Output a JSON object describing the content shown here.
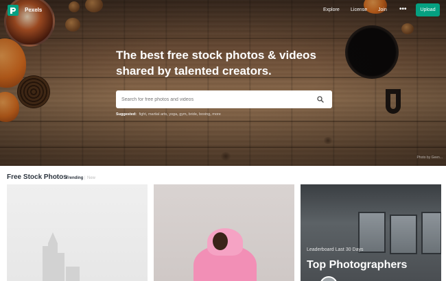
{
  "header": {
    "brand": "Pexels",
    "nav": [
      "Explore",
      "License",
      "Join"
    ],
    "more_label": "•••",
    "upload_label": "Upload"
  },
  "hero": {
    "headline": "The best free stock photos & videos shared by talented creators.",
    "search_placeholder": "Search for free photos and videos",
    "suggested_label": "Suggested:",
    "suggested_tags": [
      "fight",
      "martial arts",
      "yoga",
      "gym",
      "bride",
      "boxing",
      "more"
    ],
    "credit": "Photo by Geen..."
  },
  "section": {
    "title": "Free Stock Photos",
    "tabs": [
      "Trending",
      "New"
    ],
    "separator": "|",
    "active_tab": "Trending"
  },
  "leaderboard": {
    "kicker": "Leaderboard Last 30 Days",
    "title": "Top Photographers"
  },
  "colors": {
    "accent": "#05a081",
    "text": "#2c343e"
  },
  "icons": {
    "logo": "pexels-logo-icon",
    "search": "search-icon",
    "more": "more-dots-icon"
  }
}
